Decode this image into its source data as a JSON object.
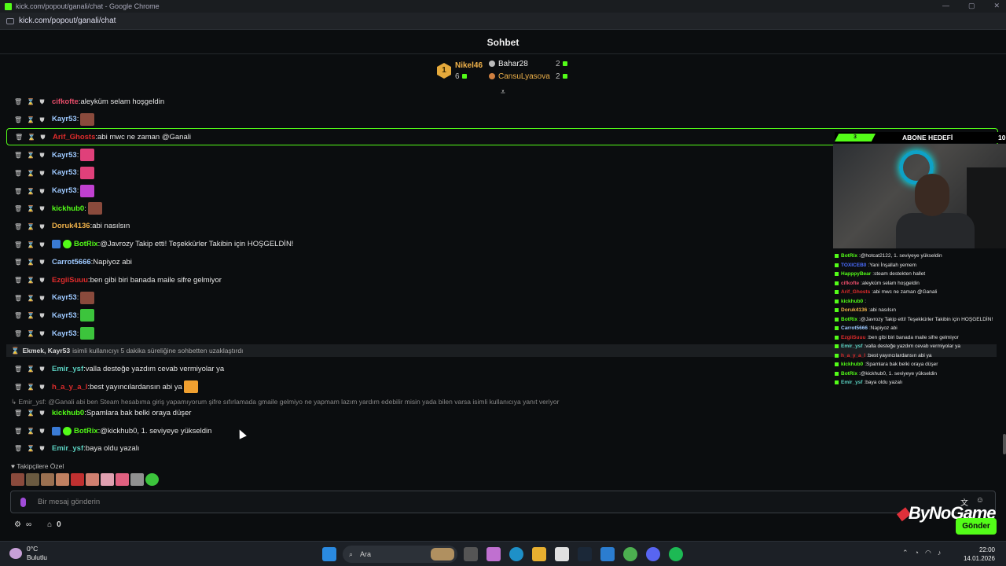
{
  "window": {
    "title": "kick.com/popout/ganali/chat - Google Chrome",
    "url": "kick.com/popout/ganali/chat",
    "controls": [
      "—",
      "▢",
      "✕"
    ]
  },
  "chat": {
    "title": "Sohbet"
  },
  "leaders": {
    "first": {
      "rank": "1",
      "name": "Nikel46",
      "count": "6"
    },
    "second": {
      "name": "Bahar28",
      "count": "2"
    },
    "third": {
      "name": "CansuLyasova",
      "count": "2"
    }
  },
  "messages": [
    {
      "user": "cifkofte",
      "color": "#e84d6a",
      "text": "aleyküm selam hoşgeldin",
      "emotes": []
    },
    {
      "user": "Kayr53",
      "color": "#9ec9ff",
      "text": "",
      "emotes": [
        "#8a4a3c"
      ]
    },
    {
      "user": "Arif_Ghosts",
      "color": "#e02c2c",
      "text": "abi mwc ne zaman @Ganali",
      "emotes": [],
      "highlight": true
    },
    {
      "user": "Kayr53",
      "color": "#9ec9ff",
      "text": "",
      "emotes": [
        "#e0407a"
      ]
    },
    {
      "user": "Kayr53",
      "color": "#9ec9ff",
      "text": "",
      "emotes": [
        "#e0407a"
      ]
    },
    {
      "user": "Kayr53",
      "color": "#9ec9ff",
      "text": "",
      "emotes": [
        "#c040d0"
      ]
    },
    {
      "user": "kickhub0",
      "color": "#53fc18",
      "text": "",
      "emotes": [
        "#8a4a3c"
      ]
    },
    {
      "user": "Doruk4136",
      "color": "#f0b24a",
      "text": "abi nasılsın",
      "emotes": []
    },
    {
      "user": "BotRix",
      "color": "#53fc18",
      "text": "@Javrozy Takip etti! Teşekkürler Takibin için HOŞGELDİN!",
      "emotes": [],
      "badges": true
    },
    {
      "user": "Carrot5666",
      "color": "#9ec9ff",
      "text": "Napiyoz abi",
      "emotes": []
    },
    {
      "user": "EzgiiSuuu",
      "color": "#e02c2c",
      "text": "ben gibi biri banada maile sifre gelmiyor",
      "emotes": []
    },
    {
      "user": "Kayr53",
      "color": "#9ec9ff",
      "text": "",
      "emotes": [
        "#8a4a3c"
      ]
    },
    {
      "user": "Kayr53",
      "color": "#9ec9ff",
      "text": "",
      "emotes": [
        "#3cc43c"
      ]
    },
    {
      "user": "Kayr53",
      "color": "#9ec9ff",
      "text": "",
      "emotes": [
        "#3cc43c"
      ]
    }
  ],
  "system_notice": {
    "actor": "Ekmek, Kayr53",
    "text": "isimli kullanıcıyı 5 dakika süreliğine sohbetten uzaklaştırdı"
  },
  "messages2": [
    {
      "user": "Emir_ysf",
      "color": "#5ad0c0",
      "text": "valla desteğe yazdım cevab vermiyolar ya",
      "emotes": []
    },
    {
      "user": "h_a_y_a_l",
      "color": "#e02c2c",
      "text": "best yayıncılardansın abi ya",
      "emotes": [
        "#f0a030"
      ]
    }
  ],
  "reply": "Emir_ysf: @Ganali abi ben Steam hesabıma giriş yapamıyorum şifre sıfırlamada gmaile gelmiyo ne yapmam lazım yardım edebilir misin yada bilen varsa isimli kullanıcıya yanıt veriyor",
  "messages3": [
    {
      "user": "kickhub0",
      "color": "#53fc18",
      "text": "Spamlara bak belki oraya düşer",
      "emotes": []
    },
    {
      "user": "BotRix",
      "color": "#53fc18",
      "text": "@kickhub0, 1. seviyeye yükseldin",
      "emotes": [],
      "badges": true
    },
    {
      "user": "Emir_ysf",
      "color": "#5ad0c0",
      "text": "baya oldu yazalı",
      "emotes": []
    }
  ],
  "followers_label": "Takipçilere Özel",
  "input": {
    "placeholder": "Bir mesaj gönderin",
    "send": "Gönder"
  },
  "bottombar": {
    "count": "0",
    "infinity": "∞"
  },
  "overlay": {
    "goal_progress": "3",
    "goal_title": "ABONE HEDEFİ",
    "goal_target": "10",
    "logo": "ByNoGame",
    "mini_chat": [
      {
        "user": "BotRix",
        "color": "#53fc18",
        "text": "@hotcat2122, 1. seviyeye yükseldin"
      },
      {
        "user": "TOXICEB0",
        "color": "#4a6cff",
        "text": "Yani İnşallah yemem"
      },
      {
        "user": "HapppyBear",
        "color": "#53fc18",
        "text": "steam destekten hallet"
      },
      {
        "user": "cifkofte",
        "color": "#e84d6a",
        "text": "aleyküm selam hoşgeldin"
      },
      {
        "user": "Arif_Ghosts",
        "color": "#e02c2c",
        "text": "abi mwc ne zaman @Ganali"
      },
      {
        "user": "kickhub0",
        "color": "#53fc18",
        "text": ""
      },
      {
        "user": "Doruk4136",
        "color": "#f0b24a",
        "text": "abi nasılsın"
      },
      {
        "user": "BotRix",
        "color": "#53fc18",
        "text": "@Javrozy Takip etti! Teşekkürler Takibin için HOŞGELDİN!"
      },
      {
        "user": "Carrot5666",
        "color": "#9ec9ff",
        "text": "Napiyoz abi"
      },
      {
        "user": "EzgiiSuuu",
        "color": "#e02c2c",
        "text": "ben gibi biri banada maile sifre gelmiyor"
      },
      {
        "user": "Emir_ysf",
        "color": "#5ad0c0",
        "text": "valla desteğe yazdım cevab vermiyolar ya"
      },
      {
        "user": "h_a_y_a_l",
        "color": "#e02c2c",
        "text": "best yayıncılardansın abi ya"
      },
      {
        "user": "kickhub0",
        "color": "#53fc18",
        "text": "Spamlara bak belki oraya düşer"
      },
      {
        "user": "BotRix",
        "color": "#53fc18",
        "text": "@kickhub0, 1. seviyeye yükseldin"
      },
      {
        "user": "Emir_ysf",
        "color": "#5ad0c0",
        "text": "baya oldu yazalı"
      }
    ]
  },
  "taskbar": {
    "temp": "0°C",
    "weather": "Bulutlu",
    "search": "Ara",
    "time": "22:00",
    "date": "14.01.2026"
  }
}
